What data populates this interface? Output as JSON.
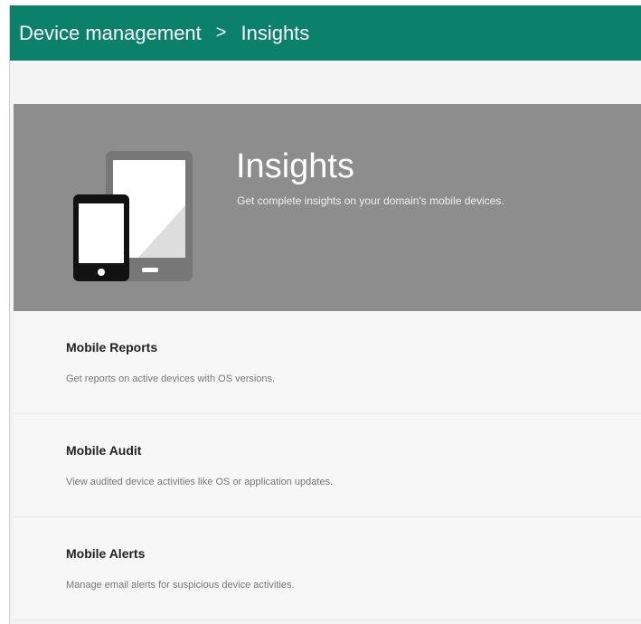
{
  "breadcrumb": {
    "root": "Device management",
    "separator": ">",
    "current": "Insights"
  },
  "hero": {
    "title": "Insights",
    "subtitle": "Get complete insights on your domain's mobile devices.",
    "icon": "devices-icon"
  },
  "items": [
    {
      "name": "Mobile Reports",
      "description": "Get reports on active devices with OS versions."
    },
    {
      "name": "Mobile Audit",
      "description": "View audited device activities like OS or application updates."
    },
    {
      "name": "Mobile Alerts",
      "description": "Manage email alerts for suspicious device activities."
    }
  ],
  "colors": {
    "topbar": "#0b806a",
    "hero": "#8d8d8d"
  }
}
